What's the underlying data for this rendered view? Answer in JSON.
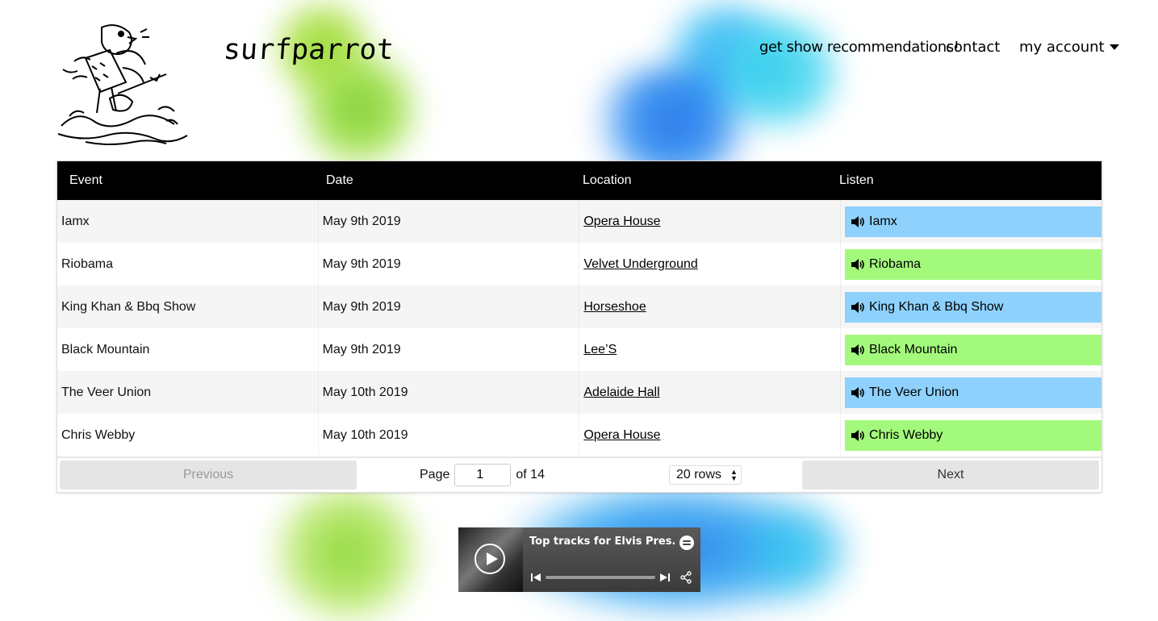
{
  "brand": {
    "name": "surfparrot"
  },
  "nav": {
    "recommendations": "get show recommendations!",
    "contact": "contact",
    "account": "my account"
  },
  "table": {
    "headers": [
      "Event",
      "Date",
      "Location",
      "Listen"
    ],
    "rows": [
      {
        "event": "Iamx",
        "date": "May 9th 2019",
        "location": "Opera House",
        "listen": "Iamx",
        "color": "#8ed1fc"
      },
      {
        "event": "Riobama",
        "date": "May 9th 2019",
        "location": "Velvet Underground",
        "listen": "Riobama",
        "color": "#a3f97c"
      },
      {
        "event": "King Khan & Bbq Show",
        "date": "May 9th 2019",
        "location": "Horseshoe",
        "listen": "King Khan & Bbq Show",
        "color": "#8ed1fc"
      },
      {
        "event": "Black Mountain",
        "date": "May 9th 2019",
        "location": "Lee’S",
        "listen": "Black Mountain",
        "color": "#a3f97c"
      },
      {
        "event": "The Veer Union",
        "date": "May 10th 2019",
        "location": "Adelaide Hall",
        "listen": "The Veer Union",
        "color": "#8ed1fc"
      },
      {
        "event": "Chris Webby",
        "date": "May 10th 2019",
        "location": "Opera House",
        "listen": "Chris Webby",
        "color": "#a3f97c"
      }
    ]
  },
  "pagination": {
    "previous": "Previous",
    "page_label": "Page",
    "page_value": "1",
    "of_label": "of 14",
    "rows_select": "20 rows",
    "next": "Next"
  },
  "player": {
    "title": "Top tracks for Elvis Pres...",
    "icons": [
      "play-icon",
      "spotify-icon",
      "previous-track-icon",
      "next-track-icon",
      "share-icon"
    ]
  }
}
